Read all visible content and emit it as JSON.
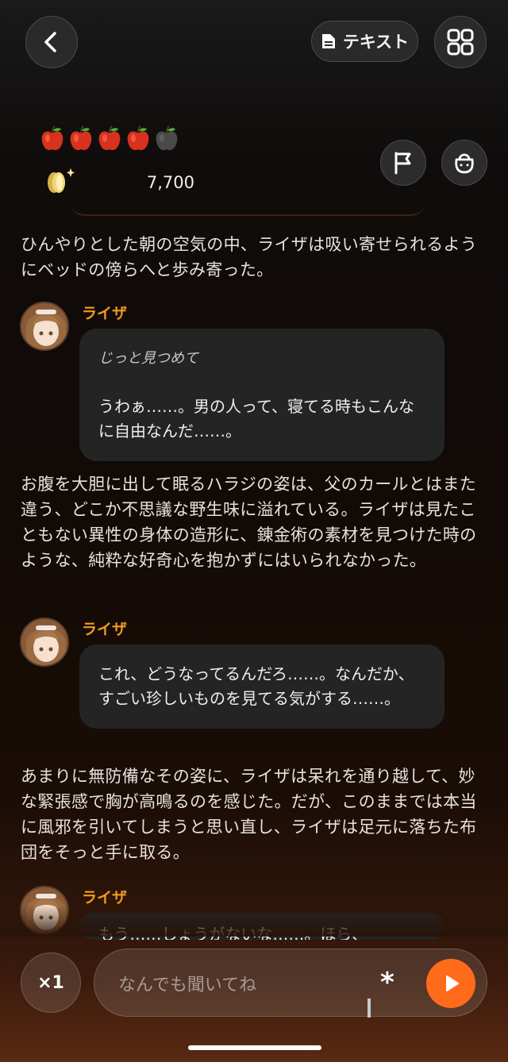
{
  "header": {
    "text_button_label": "テキスト",
    "icons": {
      "back": "chevron-left-icon",
      "text": "document-icon",
      "menu": "grid-icon"
    }
  },
  "status": {
    "apples_total": 5,
    "apples_filled": 4,
    "coin_count": "7,700",
    "icons": {
      "flag": "flag-icon",
      "bag": "bag-icon"
    }
  },
  "chat": {
    "narration_1": "ひんやりとした朝の空気の中、ライザは吸い寄せられるようにベッドの傍らへと歩み寄った。",
    "message_1": {
      "speaker": "ライザ",
      "action": "じっと見つめて",
      "text": "うわぁ……。男の人って、寝てる時もこんなに自由なんだ……。"
    },
    "narration_2": "お腹を大胆に出して眠るハラジの姿は、父のカールとはまた違う、どこか不思議な野生味に溢れている。ライザは見たこともない異性の身体の造形に、錬金術の素材を見つけた時のような、純粋な好奇心を抱かずにはいられなかった。",
    "message_2": {
      "speaker": "ライザ",
      "text": "これ、どうなってるんだろ……。なんだか、すごい珍しいものを見てる気がする……。"
    },
    "narration_3": "あまりに無防備なその姿に、ライザは呆れを通り越して、妙な緊張感で胸が高鳴るのを感じた。だが、このままでは本当に風邪を引いてしまうと思い直し、ライザは足元に落ちた布団をそっと手に取る。",
    "message_3": {
      "speaker": "ライザ",
      "text": "もう……しょうがないな……。ほら、"
    }
  },
  "input": {
    "speed_label": "×1",
    "placeholder": "なんでも聞いてね",
    "asterisk": "*",
    "send_icon": "play-icon"
  },
  "colors": {
    "accent": "#ff6b1a",
    "speaker_name": "#f39a1a"
  }
}
